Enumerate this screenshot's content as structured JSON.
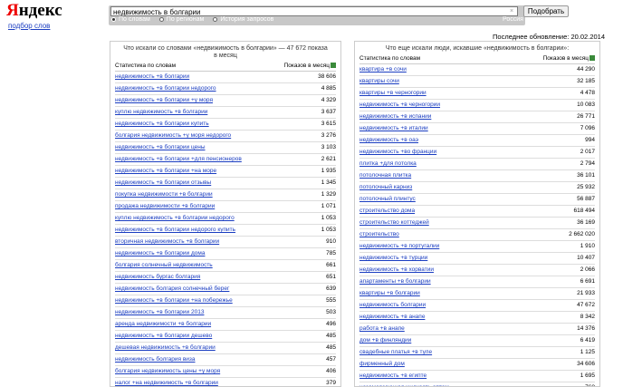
{
  "header": {
    "logo_first": "Я",
    "logo_rest": "ндекс",
    "sub_link": "подбор слов",
    "search_value": "недвижимость в болгарии",
    "clear": "×",
    "submit": "Подобрать",
    "modes": [
      "По словам",
      "По регионам",
      "История запросов"
    ],
    "region": "Россия",
    "updated": "Последнее обновление: 20.02.2014"
  },
  "left": {
    "title": "Что искали со словами «недвижимость в болгарии» — 47 672 показа в месяц",
    "col1": "Статистика по словам",
    "col2": "Показов в месяц",
    "rows": [
      {
        "kw": "недвижимость +в болгарии",
        "n": "38 606"
      },
      {
        "kw": "недвижимость +в болгарии недорого",
        "n": "4 885"
      },
      {
        "kw": "недвижимость +в болгарии +у моря",
        "n": "4 329"
      },
      {
        "kw": "куплю недвижимость +в болгарии",
        "n": "3 637"
      },
      {
        "kw": "недвижимость +в болгарии купить",
        "n": "3 615"
      },
      {
        "kw": "болгария недвижимость +у моря недорого",
        "n": "3 276"
      },
      {
        "kw": "недвижимость +в болгарии цены",
        "n": "3 103"
      },
      {
        "kw": "недвижимость +в болгарии +для пенсионеров",
        "n": "2 621"
      },
      {
        "kw": "недвижимость +в болгарии +на море",
        "n": "1 935"
      },
      {
        "kw": "недвижимость +в болгарии отзывы",
        "n": "1 345"
      },
      {
        "kw": "покупка недвижимости +в болгарии",
        "n": "1 329"
      },
      {
        "kw": "продажа недвижимости +в болгарии",
        "n": "1 071"
      },
      {
        "kw": "куплю недвижимость +в болгарии недорого",
        "n": "1 053"
      },
      {
        "kw": "недвижимость +в болгарии недорого купить",
        "n": "1 053"
      },
      {
        "kw": "вторичная недвижимость +в болгарии",
        "n": "910"
      },
      {
        "kw": "недвижимость +в болгарии дома",
        "n": "785"
      },
      {
        "kw": "болгария солнечный недвижимость",
        "n": "661"
      },
      {
        "kw": "недвижимость бургас болгария",
        "n": "651"
      },
      {
        "kw": "недвижимость болгария солнечный берег",
        "n": "639"
      },
      {
        "kw": "недвижимость +в болгарии +на побережье",
        "n": "555"
      },
      {
        "kw": "недвижимость +в болгарии 2013",
        "n": "503"
      },
      {
        "kw": "аренда недвижимости +в болгарии",
        "n": "496"
      },
      {
        "kw": "недвижимость +в болгарии дешево",
        "n": "485"
      },
      {
        "kw": "дешевая недвижимость +в болгарии",
        "n": "485"
      },
      {
        "kw": "недвижимость болгария виза",
        "n": "457"
      },
      {
        "kw": "болгария недвижимость цены +у моря",
        "n": "406"
      },
      {
        "kw": "налог +на недвижимость +в болгарии",
        "n": "379"
      },
      {
        "kw": "недвижимость +в болгарии форум",
        "n": "367"
      }
    ]
  },
  "right": {
    "title": "Что еще искали люди, искавшие «недвижимость в болгарии»:",
    "col1": "Статистика по словам",
    "col2": "Показов в месяц",
    "rows": [
      {
        "kw": "квартира +в сочи",
        "n": "44 290"
      },
      {
        "kw": "квартиры сочи",
        "n": "32 185"
      },
      {
        "kw": "квартиры +в черногории",
        "n": "4 478"
      },
      {
        "kw": "недвижимость +в черногории",
        "n": "10 083"
      },
      {
        "kw": "недвижимость +в испании",
        "n": "26 771"
      },
      {
        "kw": "недвижимость +в италии",
        "n": "7 096"
      },
      {
        "kw": "недвижимость +в оаэ",
        "n": "994"
      },
      {
        "kw": "недвижимость +во франции",
        "n": "2 017"
      },
      {
        "kw": "плитка +для потолка",
        "n": "2 794"
      },
      {
        "kw": "потолочная плитка",
        "n": "36 101"
      },
      {
        "kw": "потолочный карниз",
        "n": "25 932"
      },
      {
        "kw": "потолочный плинтус",
        "n": "56 887"
      },
      {
        "kw": "строительство дома",
        "n": "618 494"
      },
      {
        "kw": "строительство коттеджей",
        "n": "36 169"
      },
      {
        "kw": "строительство",
        "n": "2 662 020"
      },
      {
        "kw": "недвижимость +в португалии",
        "n": "1 910"
      },
      {
        "kw": "недвижимость +в турции",
        "n": "10 407"
      },
      {
        "kw": "недвижимость +в хорватии",
        "n": "2 066"
      },
      {
        "kw": "апартаменты +в болгарии",
        "n": "6 691"
      },
      {
        "kw": "квартиры +в болгарии",
        "n": "21 933"
      },
      {
        "kw": "недвижимость болгарии",
        "n": "47 672"
      },
      {
        "kw": "недвижимость +в анапе",
        "n": "8 342"
      },
      {
        "kw": "работа +в анапе",
        "n": "14 376"
      },
      {
        "kw": "дом +в финляндии",
        "n": "6 419"
      },
      {
        "kw": "свадебные платья +в туле",
        "n": "1 125"
      },
      {
        "kw": "фирменный дом",
        "n": "34 606"
      },
      {
        "kw": "недвижимость +в египте",
        "n": "1 695"
      },
      {
        "kw": "незамерзающая жидкость оптом",
        "n": "768"
      },
      {
        "kw": "незамерзайка оптом",
        "n": "3 996"
      }
    ]
  }
}
